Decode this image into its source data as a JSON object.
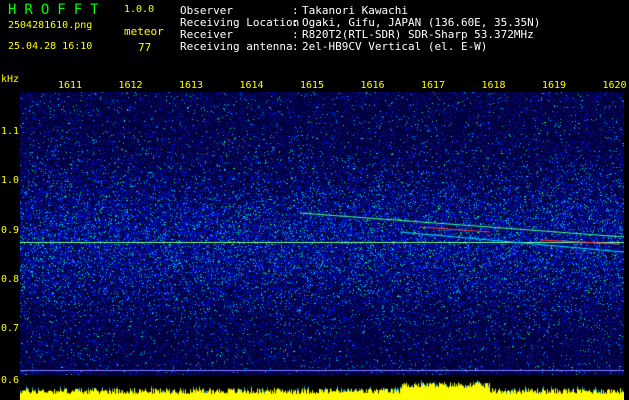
{
  "app": {
    "title": "HROFFT",
    "version": "1.0.0"
  },
  "file_name": "2504281610.png",
  "mode": "meteor",
  "datetime": "25.04.28 16:10",
  "count": "77",
  "info": [
    {
      "label": "Observer",
      "value": "Takanori Kawachi"
    },
    {
      "label": "Receiving Location",
      "value": "Ogaki, Gifu, JAPAN (136.60E, 35.35N)"
    },
    {
      "label": "Receiver",
      "value": "R820T2(RTL-SDR) SDR-Sharp 53.372MHz"
    },
    {
      "label": "Receiving antenna",
      "value": "2el-HB9CV Vertical (el. E-W)"
    }
  ],
  "axis": {
    "freq_unit": "kHz",
    "time_ticks": [
      "1611",
      "1612",
      "1613",
      "1614",
      "1615",
      "1616",
      "1617",
      "1618",
      "1619",
      "1620"
    ],
    "freq_ticks": [
      "1.1",
      "1.0",
      "0.9",
      "0.8",
      "0.7",
      "0.6"
    ]
  },
  "colors": {
    "green": "#00ff00",
    "yellow": "#ffff00",
    "background": "#000040"
  }
}
